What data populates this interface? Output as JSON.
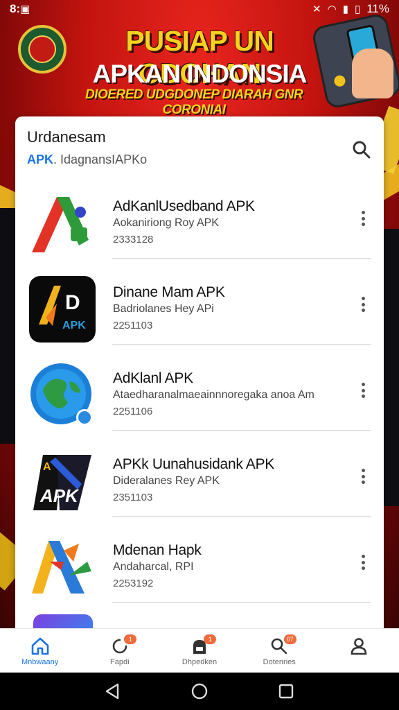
{
  "status_bar": {
    "time": "8:",
    "battery": "11%"
  },
  "banner": {
    "title": "PUSIAP UN ODOHAN",
    "subtitle": "APKAN INDONSIA",
    "tagline": "DIOERED UDGDONEP DIARAH GNR CORONIAI"
  },
  "card": {
    "title": "Urdanesam",
    "subtitle_tag": "APK",
    "subtitle_rest": ". IdagnansIAPKo"
  },
  "apps": [
    {
      "name": "AdKanlUsedband APK",
      "developer": "Aokaniriong Roy APK",
      "number": "2333128",
      "icon": "red-green-a-logo-icon"
    },
    {
      "name": "Dinane Mam APK",
      "developer": "Badriolanes Hey APi",
      "number": "2251103",
      "icon": "black-d-apk-logo-icon"
    },
    {
      "name": "AdKlanl APK",
      "developer": "Ataedharanalmaeainnnoregaka anoa Am",
      "number": "2251106",
      "icon": "globe-logo-icon"
    },
    {
      "name": "APKk Uunahusidank APK",
      "developer": "Dideralanes Rey APK",
      "number": "2351103",
      "icon": "dark-apk-logo-icon"
    },
    {
      "name": "Mdenan Hapk",
      "developer": "Andaharcal, RPI",
      "number": "2253192",
      "icon": "colorful-a-logo-icon"
    }
  ],
  "bottom_nav": [
    {
      "label": "Mnbwaany",
      "icon": "home-icon",
      "badge": "",
      "active": true
    },
    {
      "label": "Fapdi",
      "icon": "refresh-icon",
      "badge": "1",
      "active": false
    },
    {
      "label": "Dhpedken",
      "icon": "backpack-icon",
      "badge": "1",
      "active": false
    },
    {
      "label": "Dotenries",
      "icon": "search-icon",
      "badge": "07",
      "active": false
    },
    {
      "label": "",
      "icon": "profile-icon",
      "badge": "",
      "active": false
    }
  ],
  "colors": {
    "accent": "#1a73e8",
    "banner_red": "#c4140f",
    "banner_yellow": "#f5d21e",
    "badge": "#f06a3a"
  }
}
